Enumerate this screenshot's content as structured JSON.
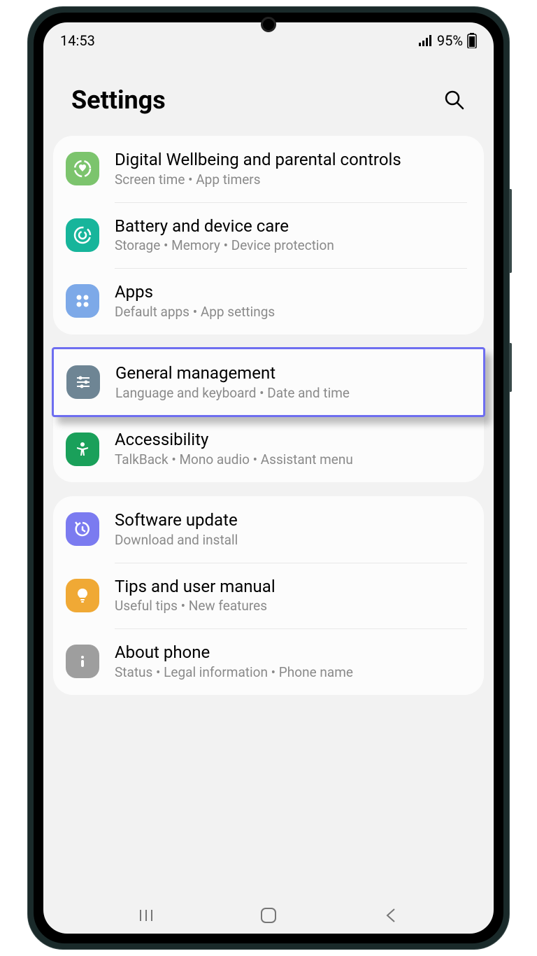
{
  "status": {
    "time": "14:53",
    "battery_percent": "95%"
  },
  "header": {
    "title": "Settings"
  },
  "groups": [
    {
      "items": [
        {
          "id": "wellbeing",
          "title": "Digital Wellbeing and parental controls",
          "sub": "Screen time  •  App timers",
          "icon": "wellbeing",
          "color": "#7cc46d"
        },
        {
          "id": "battery",
          "title": "Battery and device care",
          "sub": "Storage  •  Memory  •  Device protection",
          "icon": "care",
          "color": "#17b59b"
        },
        {
          "id": "apps",
          "title": "Apps",
          "sub": "Default apps  •  App settings",
          "icon": "apps",
          "color": "#7da9e8"
        }
      ]
    },
    {
      "items": [
        {
          "id": "general",
          "title": "General management",
          "sub": "Language and keyboard  •  Date and time",
          "icon": "sliders",
          "color": "#6e8594",
          "highlighted": true
        },
        {
          "id": "accessibility",
          "title": "Accessibility",
          "sub": "TalkBack  •  Mono audio  •  Assistant menu",
          "icon": "accessibility",
          "color": "#1aa05a"
        }
      ]
    },
    {
      "items": [
        {
          "id": "update",
          "title": "Software update",
          "sub": "Download and install",
          "icon": "update",
          "color": "#7b7bf0"
        },
        {
          "id": "tips",
          "title": "Tips and user manual",
          "sub": "Useful tips  •  New features",
          "icon": "bulb",
          "color": "#f0a935"
        },
        {
          "id": "about",
          "title": "About phone",
          "sub": "Status  •  Legal information  •  Phone name",
          "icon": "info",
          "color": "#9e9e9e"
        }
      ]
    }
  ]
}
